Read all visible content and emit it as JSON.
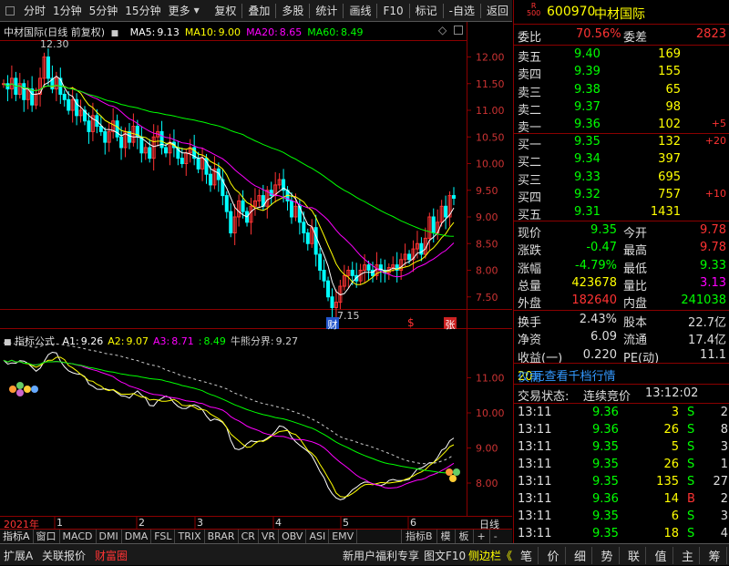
{
  "toolbar": {
    "items": [
      "分时",
      "1分钟",
      "5分钟",
      "15分钟",
      "更多",
      "复权",
      "叠加",
      "多股",
      "统计",
      "画线",
      "F10",
      "标记",
      "-自选",
      "返回"
    ]
  },
  "kline": {
    "title": "中材国际(日线 前复权)",
    "ma": [
      {
        "label": "MA5:",
        "value": "9.13",
        "color": "#ffffff"
      },
      {
        "label": "MA10:",
        "value": "9.00",
        "color": "#ffff00"
      },
      {
        "label": "MA20:",
        "value": "8.65",
        "color": "#ff00ff"
      },
      {
        "label": "MA60:",
        "value": "8.49",
        "color": "#00ff00"
      }
    ],
    "high_label": "12.30",
    "low_label": "7.15",
    "y_ticks": [
      "12.00",
      "11.50",
      "11.00",
      "10.50",
      "10.00",
      "9.50",
      "9.00",
      "8.50",
      "8.00",
      "7.50"
    ],
    "markers": [
      "财",
      "$",
      "张"
    ]
  },
  "indicator": {
    "label": "指标公式",
    "values": [
      {
        "label": "A1:",
        "value": "9.26",
        "color": "#ffffff"
      },
      {
        "label": "A2:",
        "value": "9.07",
        "color": "#ffff00"
      },
      {
        "label": "A3:",
        "value": "8.71",
        "color": "#ff00ff"
      },
      {
        "label": ":",
        "value": "8.49",
        "color": "#00ff00"
      },
      {
        "label": "牛熊分界:",
        "value": "9.27",
        "color": "#cccccc"
      }
    ],
    "y_ticks": [
      "11.00",
      "10.00",
      "9.00",
      "8.00"
    ]
  },
  "xaxis": {
    "year": "2021年",
    "months": [
      "1",
      "2",
      "3",
      "4",
      "5",
      "6"
    ],
    "period": "日线"
  },
  "ind_tabs": [
    "指标A",
    "窗口",
    "MACD",
    "DMI",
    "DMA",
    "FSL",
    "TRIX",
    "BRAR",
    "CR",
    "VR",
    "OBV",
    "ASI",
    "EMV"
  ],
  "ind_tabs_right": [
    "指标B",
    "模",
    "板",
    "+",
    "-"
  ],
  "stock": {
    "badge_r": "R",
    "badge_num": "500",
    "code": "600970",
    "name": "中材国际"
  },
  "weibi": {
    "l1": "委比",
    "v1": "70.56%",
    "l2": "委差",
    "v2": "2823"
  },
  "sells": [
    {
      "label": "卖五",
      "price": "9.40",
      "vol": "169",
      "chg": ""
    },
    {
      "label": "卖四",
      "price": "9.39",
      "vol": "155",
      "chg": ""
    },
    {
      "label": "卖三",
      "price": "9.38",
      "vol": "65",
      "chg": ""
    },
    {
      "label": "卖二",
      "price": "9.37",
      "vol": "98",
      "chg": ""
    },
    {
      "label": "卖一",
      "price": "9.36",
      "vol": "102",
      "chg": "+5"
    }
  ],
  "buys": [
    {
      "label": "买一",
      "price": "9.35",
      "vol": "132",
      "chg": "+20"
    },
    {
      "label": "买二",
      "price": "9.34",
      "vol": "397",
      "chg": ""
    },
    {
      "label": "买三",
      "price": "9.33",
      "vol": "695",
      "chg": ""
    },
    {
      "label": "买四",
      "price": "9.32",
      "vol": "757",
      "chg": "+10"
    },
    {
      "label": "买五",
      "price": "9.31",
      "vol": "1431",
      "chg": ""
    }
  ],
  "quote": [
    {
      "l1": "现价",
      "v1": "9.35",
      "c1": "#00ff00",
      "l2": "今开",
      "v2": "9.78",
      "c2": "#ff3333"
    },
    {
      "l1": "涨跌",
      "v1": "-0.47",
      "c1": "#00ff00",
      "l2": "最高",
      "v2": "9.78",
      "c2": "#ff3333"
    },
    {
      "l1": "涨幅",
      "v1": "-4.79%",
      "c1": "#00ff00",
      "l2": "最低",
      "v2": "9.33",
      "c2": "#00ff00"
    },
    {
      "l1": "总量",
      "v1": "423678",
      "c1": "#ffff00",
      "l2": "量比",
      "v2": "3.13",
      "c2": "#ff00ff"
    },
    {
      "l1": "外盘",
      "v1": "182640",
      "c1": "#ff3333",
      "l2": "内盘",
      "v2": "241038",
      "c2": "#00ff00"
    }
  ],
  "quote2": [
    {
      "l1": "换手",
      "v1": "2.43%",
      "l2": "股本",
      "v2": "22.7亿"
    },
    {
      "l1": "净资",
      "v1": "6.09",
      "l2": "流通",
      "v2": "17.4亿"
    },
    {
      "l1": "收益(一)",
      "v1": "0.220",
      "l2": "PE(动)",
      "v2": "11.1"
    }
  ],
  "promo": {
    "a": "仅需",
    "b": "20",
    "c": "元查看千档行情"
  },
  "trade_state": {
    "label": "交易状态:",
    "value": "连续竞价",
    "time": "13:12:02"
  },
  "ticks": [
    {
      "t": "13:11",
      "p": "9.36",
      "v": "3",
      "s": "S",
      "n": "2"
    },
    {
      "t": "13:11",
      "p": "9.36",
      "v": "26",
      "s": "S",
      "n": "8"
    },
    {
      "t": "13:11",
      "p": "9.35",
      "v": "5",
      "s": "S",
      "n": "3"
    },
    {
      "t": "13:11",
      "p": "9.35",
      "v": "26",
      "s": "S",
      "n": "1"
    },
    {
      "t": "13:11",
      "p": "9.35",
      "v": "135",
      "s": "S",
      "n": "27"
    },
    {
      "t": "13:11",
      "p": "9.36",
      "v": "14",
      "s": "B",
      "n": "2"
    },
    {
      "t": "13:11",
      "p": "9.35",
      "v": "6",
      "s": "S",
      "n": "3"
    },
    {
      "t": "13:11",
      "p": "9.35",
      "v": "18",
      "s": "S",
      "n": "4"
    }
  ],
  "bottom": {
    "ext": "扩展A",
    "items": [
      "关联报价",
      "财富圈"
    ],
    "news": "新用户福利专享",
    "f10": "图文F10",
    "side": "侧边栏《"
  },
  "right_tabs": [
    "笔",
    "价",
    "细",
    "势",
    "联",
    "值",
    "主",
    "筹"
  ]
}
